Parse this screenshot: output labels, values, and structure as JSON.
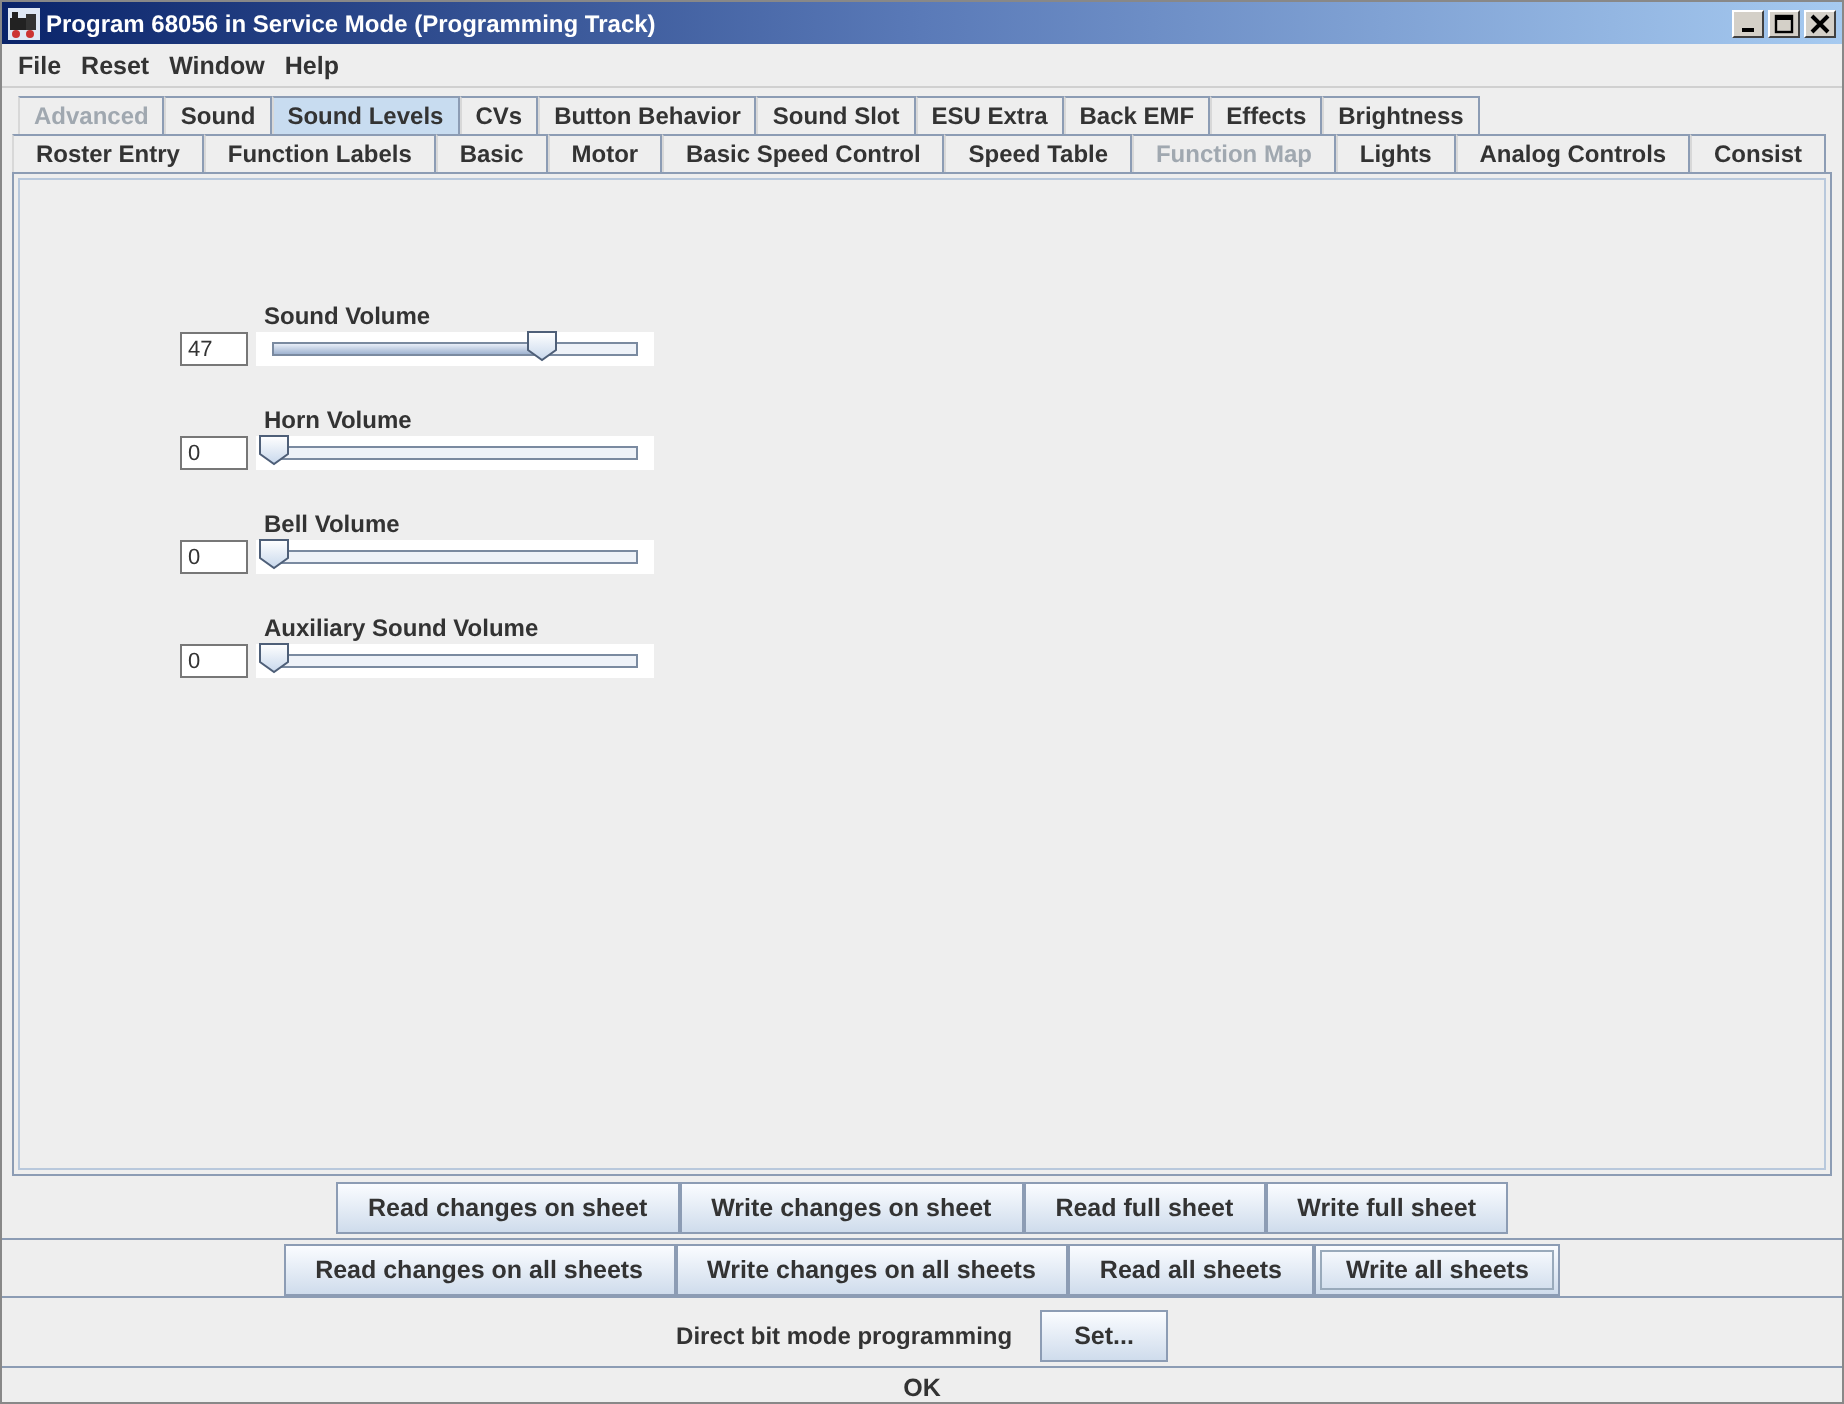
{
  "window": {
    "title": "Program 68056 in Service Mode (Programming Track)"
  },
  "menu": [
    "File",
    "Reset",
    "Window",
    "Help"
  ],
  "tab_rows": [
    [
      {
        "label": "Advanced",
        "selected": false,
        "disabled": true
      },
      {
        "label": "Sound",
        "selected": false,
        "disabled": false
      },
      {
        "label": "Sound Levels",
        "selected": true,
        "disabled": false
      },
      {
        "label": "CVs",
        "selected": false,
        "disabled": false
      },
      {
        "label": "Button Behavior",
        "selected": false,
        "disabled": false
      },
      {
        "label": "Sound Slot",
        "selected": false,
        "disabled": false
      },
      {
        "label": "ESU Extra",
        "selected": false,
        "disabled": false
      },
      {
        "label": "Back EMF",
        "selected": false,
        "disabled": false
      },
      {
        "label": "Effects",
        "selected": false,
        "disabled": false
      },
      {
        "label": "Brightness",
        "selected": false,
        "disabled": false
      }
    ],
    [
      {
        "label": "Roster Entry",
        "selected": false,
        "disabled": false
      },
      {
        "label": "Function Labels",
        "selected": false,
        "disabled": false
      },
      {
        "label": "Basic",
        "selected": false,
        "disabled": false
      },
      {
        "label": "Motor",
        "selected": false,
        "disabled": false
      },
      {
        "label": "Basic Speed Control",
        "selected": false,
        "disabled": false
      },
      {
        "label": "Speed Table",
        "selected": false,
        "disabled": false
      },
      {
        "label": "Function Map",
        "selected": false,
        "disabled": true
      },
      {
        "label": "Lights",
        "selected": false,
        "disabled": false
      },
      {
        "label": "Analog Controls",
        "selected": false,
        "disabled": false
      },
      {
        "label": "Consist",
        "selected": false,
        "disabled": false
      }
    ]
  ],
  "sliders": [
    {
      "label": "Sound Volume",
      "value": "47",
      "level": 0.74
    },
    {
      "label": "Horn Volume",
      "value": "0",
      "level": 0
    },
    {
      "label": "Bell Volume",
      "value": "0",
      "level": 0
    },
    {
      "label": "Auxiliary Sound Volume",
      "value": "0",
      "level": 0
    }
  ],
  "sheet_buttons": [
    {
      "label": "Read changes on sheet",
      "focused": false
    },
    {
      "label": "Write changes on sheet",
      "focused": false
    },
    {
      "label": "Read full sheet",
      "focused": false
    },
    {
      "label": "Write full sheet",
      "focused": false
    }
  ],
  "all_buttons": [
    {
      "label": "Read changes on all sheets",
      "focused": false
    },
    {
      "label": "Write changes on all sheets",
      "focused": false
    },
    {
      "label": "Read all sheets",
      "focused": false
    },
    {
      "label": "Write all sheets",
      "focused": true
    }
  ],
  "mode": {
    "label": "Direct bit mode programming",
    "button": "Set..."
  },
  "status_bar": "OK"
}
